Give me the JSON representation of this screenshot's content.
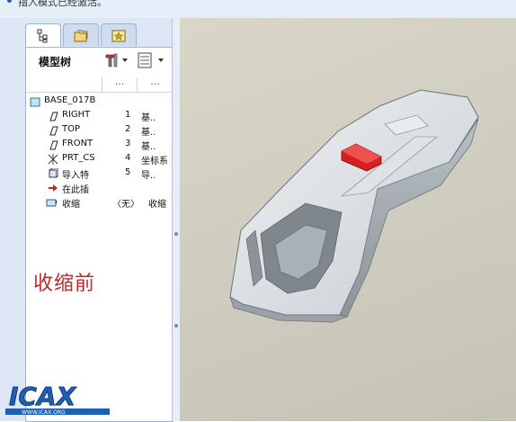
{
  "topbar": {
    "message": "指入模式已经激活。"
  },
  "tabs": [
    {
      "icon": "model-tree-icon",
      "active": true
    },
    {
      "icon": "folder-browser-icon",
      "active": false
    },
    {
      "icon": "favorites-icon",
      "active": false
    }
  ],
  "tree_header": {
    "title": "模型树",
    "settings_icon": "tree-settings-icon",
    "columns_icon": "tree-columns-icon"
  },
  "columns": {
    "col1": "...",
    "col2": "..."
  },
  "tree_items": [
    {
      "icon": "part-icon",
      "name": "BASE_017B",
      "col1": "",
      "col2": ""
    },
    {
      "icon": "datum-plane-icon",
      "name": "RIGHT",
      "col1": "1",
      "col2": "基.."
    },
    {
      "icon": "datum-plane-icon",
      "name": "TOP",
      "col1": "2",
      "col2": "基.."
    },
    {
      "icon": "datum-plane-icon",
      "name": "FRONT",
      "col1": "3",
      "col2": "基.."
    },
    {
      "icon": "coordinate-system-icon",
      "name": "PRT_CS",
      "col1": "4",
      "col2": "坐标系"
    },
    {
      "icon": "import-feature-icon",
      "name": "导入特",
      "col1": "5",
      "col2": "导.."
    },
    {
      "icon": "insert-here-arrow-icon",
      "name": "在此插",
      "col1": "",
      "col2": ""
    },
    {
      "icon": "shrinkwrap-icon",
      "name": "收缩",
      "col1": "〈无〉",
      "col2": "收缩"
    }
  ],
  "annotation": "收缩前",
  "logo_text": "ICAX",
  "logo_subtext": "WWW.ICAX.ORG",
  "colors": {
    "accent": "#2a5ab4",
    "annotation": "#c0282b",
    "highlight_feature": "#d81e1e"
  }
}
